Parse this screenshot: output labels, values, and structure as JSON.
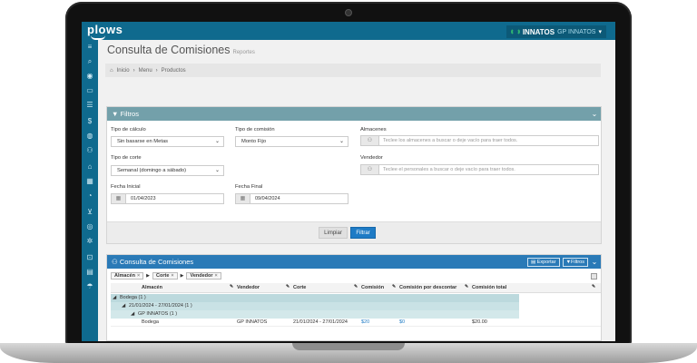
{
  "app": {
    "logo": "plows",
    "brand": "INNATOS",
    "brand_sub": "GP INNATOS"
  },
  "page": {
    "title": "Consulta de Comisiones",
    "subtitle": "Reportes"
  },
  "breadcrumb": {
    "home": "Inicio",
    "menu": "Menu",
    "current": "Productos",
    "sep": "›"
  },
  "filters": {
    "header": "Filtros",
    "tipo_calculo_label": "Tipo de cálculo",
    "tipo_calculo_value": "Sin basarse en Metas",
    "tipo_comision_label": "Tipo de comisión",
    "tipo_comision_value": "Monto Fijo",
    "almacenes_label": "Almacenes",
    "almacenes_placeholder": "Teclee los almacenes a buscar o deje vacío para traer todos.",
    "tipo_corte_label": "Tipo de corte",
    "tipo_corte_value": "Semanal (domingo a sábado)",
    "vendedor_label": "Vendedor",
    "vendedor_placeholder": "Teclee el personales a buscar o deje vacío para traer todos.",
    "fecha_inicial_label": "Fecha Inicial",
    "fecha_inicial_value": "01/04/2023",
    "fecha_final_label": "Fecha Final",
    "fecha_final_value": "09/04/2024",
    "clear_button": "Limpiar",
    "filter_button": "Filtrar"
  },
  "grid": {
    "header": "Consulta de Comisiones",
    "export_button": "Exportar",
    "filters_button": "Filtros",
    "group_chips": [
      "Almacén",
      "Corte",
      "Vendedor"
    ],
    "columns": [
      "Almacén",
      "Vendedor",
      "Corte",
      "Comisión",
      "Comisión por descontar",
      "Comisión total"
    ],
    "group1": "Bodega (1 )",
    "group2": "21/01/2024 - 27/01/2024 (1 )",
    "group3": "GP INNATOS (1 )",
    "row": {
      "almacen": "Bodega",
      "vendedor": "GP INNATOS",
      "corte": "21/01/2024 - 27/01/2024",
      "comision": "$20",
      "por_descontar": "$0",
      "total": "$20.00"
    }
  },
  "sidebar_icons": [
    "search-icon",
    "eye-icon",
    "inbox-icon",
    "list-icon",
    "dollar-icon",
    "globe-icon",
    "users-icon",
    "bank-icon",
    "calculator-icon",
    "chart-icon",
    "cart-icon",
    "world-icon",
    "gear-icon",
    "lock-icon",
    "book-icon",
    "umbrella-icon"
  ],
  "colors": {
    "topbar": "#0f6a8e",
    "filters_header": "#73a0aa",
    "grid_header": "#2a7ab7",
    "primary_button": "#1e7bc5"
  }
}
